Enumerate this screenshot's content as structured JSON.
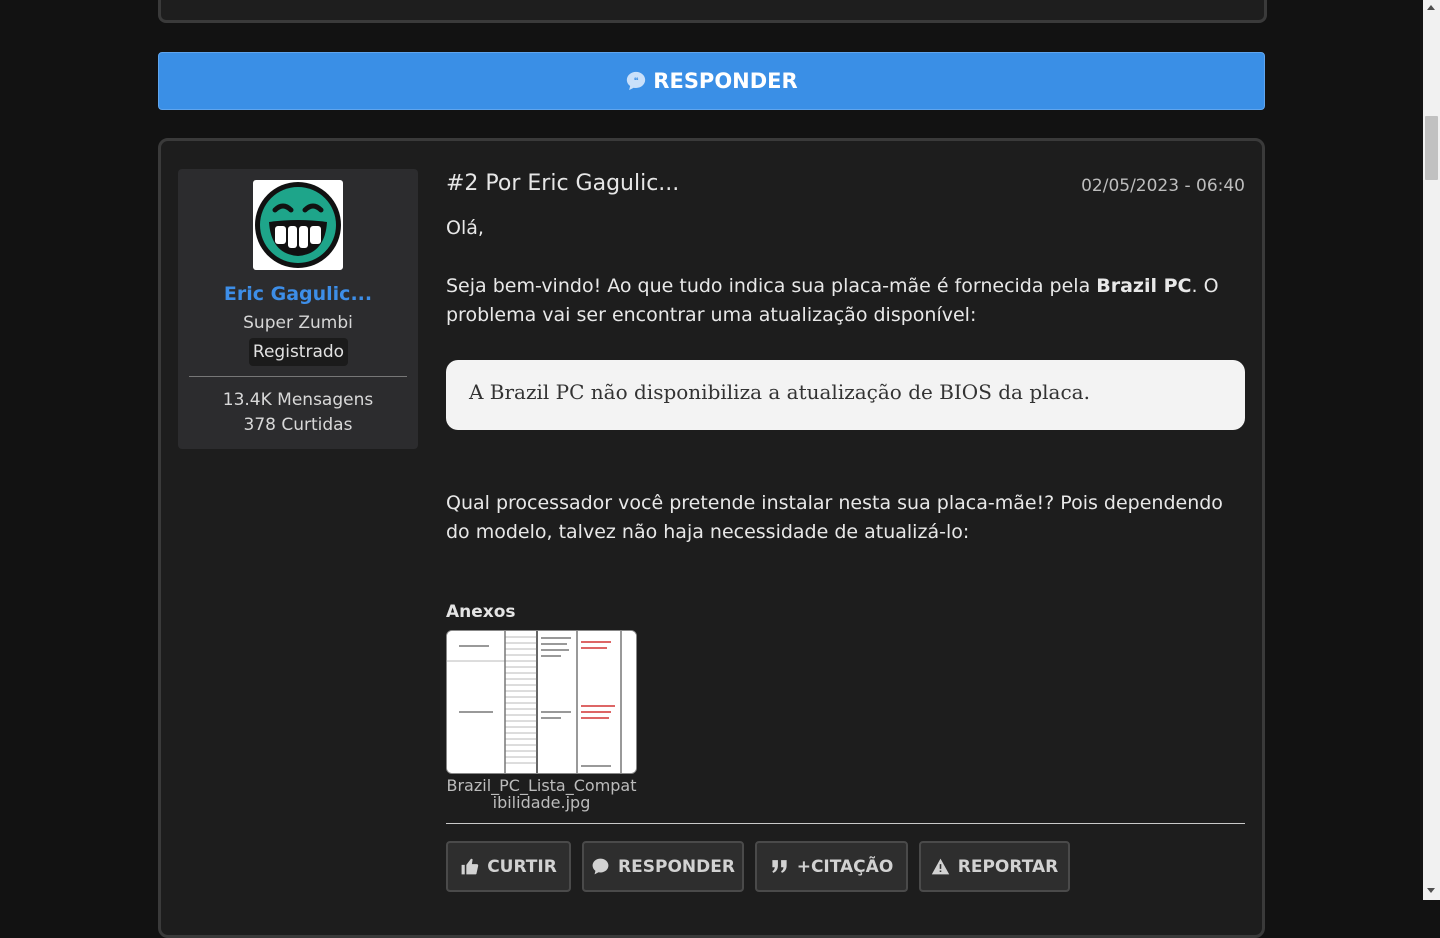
{
  "reply_bar": {
    "label": "RESPONDER"
  },
  "post": {
    "header": "#2 Por Eric Gagulic...",
    "date": "02/05/2023 - 06:40",
    "greeting": "Olá,",
    "paragraph1_before": "Seja bem-vindo! Ao que tudo indica sua placa-mãe é fornecida pela ",
    "paragraph1_bold": "Brazil PC",
    "paragraph1_after": ". O problema vai ser encontrar uma atualização disponível:",
    "quote_text": "A Brazil PC não disponibiliza a atualização de BIOS da placa.",
    "paragraph2": "Qual processador você pretende instalar nesta sua placa-mãe!? Pois dependendo do modelo, talvez não haja necessidade de atualizá-lo:",
    "attachments_label": "Anexos",
    "attachment_filename": "Brazil_PC_Lista_Compatibilidade.jpg"
  },
  "author": {
    "name": "Eric Gagulic...",
    "title": "Super Zumbi",
    "badge": "Registrado",
    "messages": "13.4K Mensagens",
    "likes": "378 Curtidas"
  },
  "actions": {
    "like": "CURTIR",
    "reply": "RESPONDER",
    "quote": "+CITAÇÃO",
    "report": "REPORTAR"
  },
  "colors": {
    "accent": "#3a8fe6",
    "username": "#3d8ee8",
    "background": "#121212",
    "avatar_green": "#1ea58a"
  },
  "icons": {
    "reply": "chat-bubble-icon",
    "like": "thumbs-up-icon",
    "quote": "quote-icon",
    "report": "warning-icon"
  }
}
